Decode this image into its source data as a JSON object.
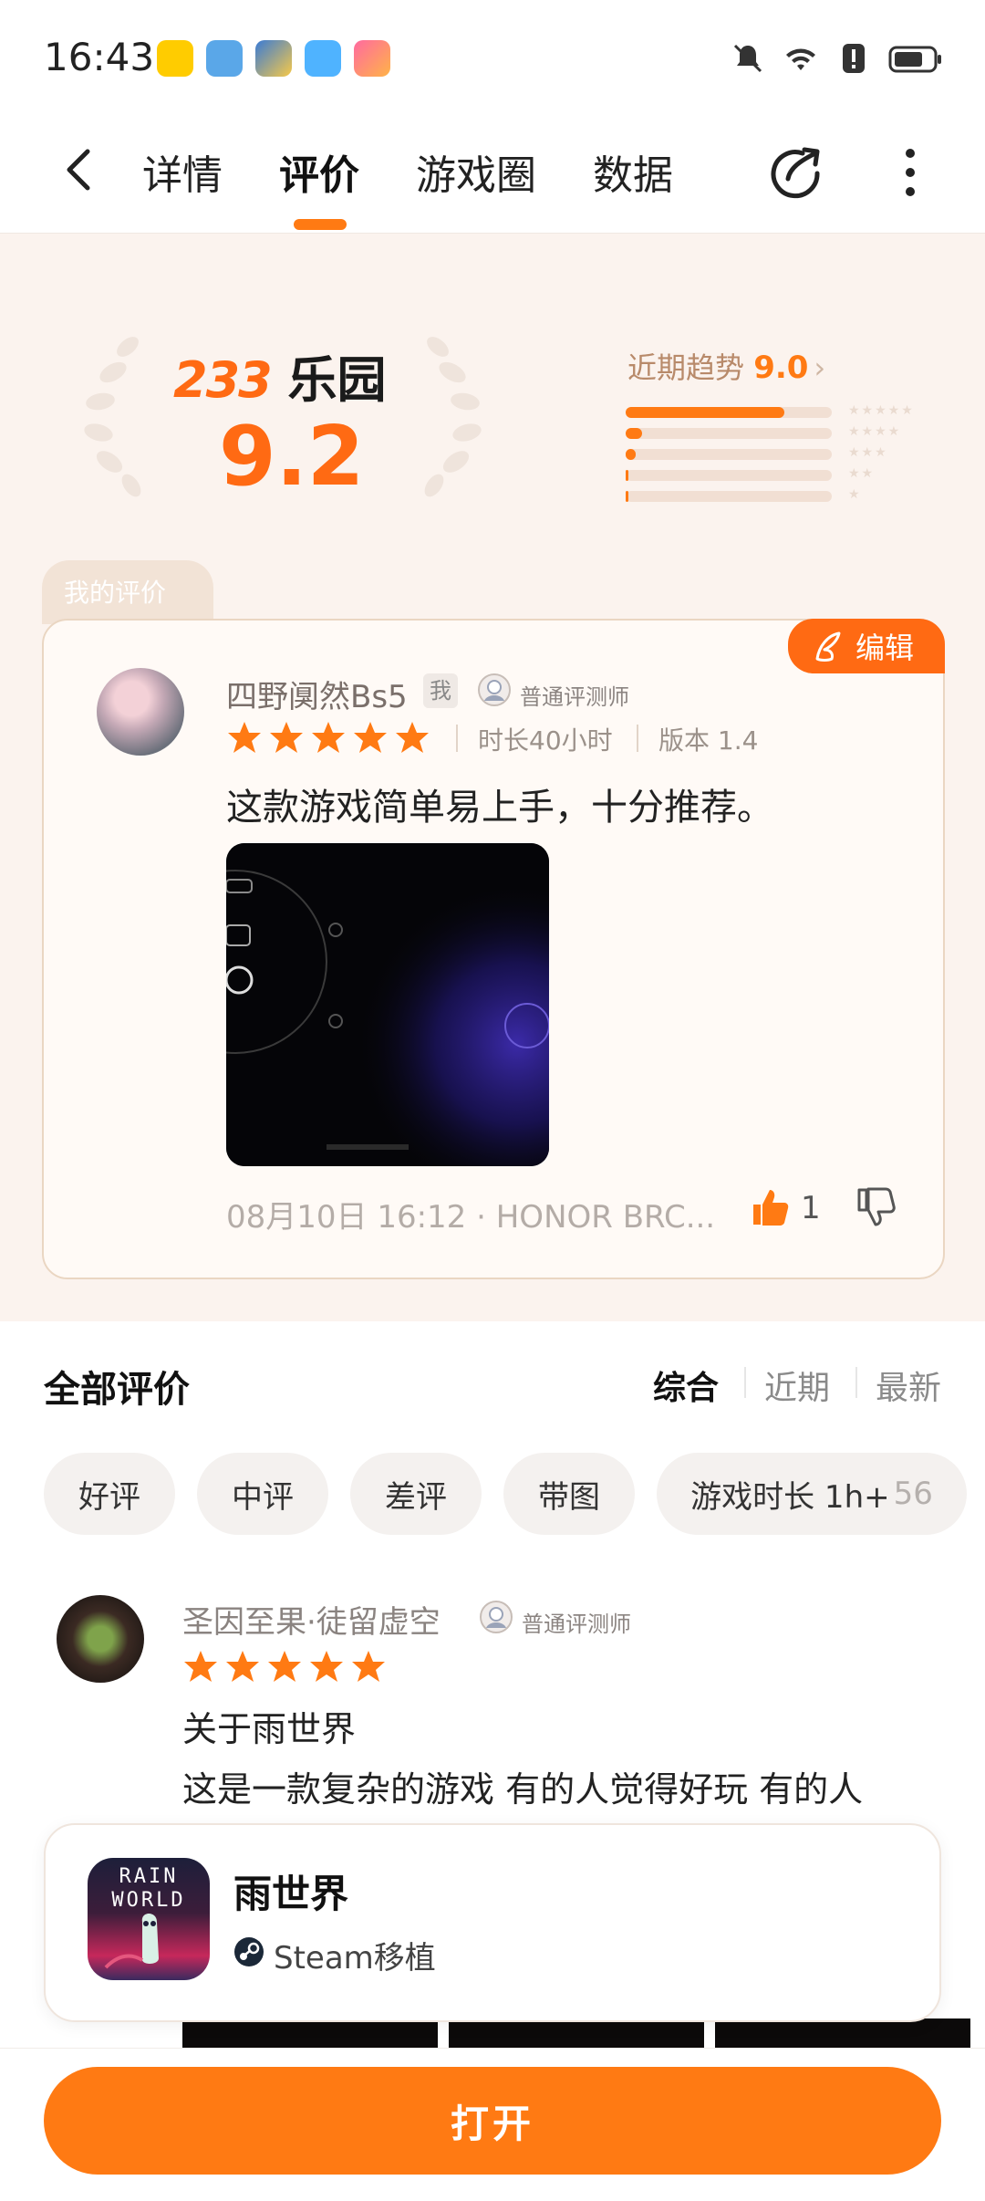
{
  "status_bar": {
    "time": "16:43"
  },
  "nav": {
    "tabs": [
      {
        "label": "详情"
      },
      {
        "label": "评价"
      },
      {
        "label": "游戏圈"
      },
      {
        "label": "数据"
      }
    ],
    "active_tab": "评价"
  },
  "score": {
    "brand_number": "233",
    "brand_text": "乐园",
    "value": "9.2",
    "trend_label": "近期趋势",
    "trend_value": "9.0",
    "distribution": [
      0.77,
      0.08,
      0.05,
      0.015,
      0.015
    ]
  },
  "my_review": {
    "tab_label": "我的评价",
    "edit_label": "编辑",
    "user_name": "四野阒然Bs5",
    "me_tag": "我",
    "rank": "普通评测师",
    "stars": 5,
    "playtime": "时长40小时",
    "version": "版本 1.4",
    "text": "这款游戏简单易上手，十分推荐。",
    "date_device": "08月10日 16:12 · HONOR BRC...",
    "likes": "1"
  },
  "all_reviews": {
    "title": "全部评价",
    "sort_options": [
      {
        "label": "综合"
      },
      {
        "label": "近期"
      },
      {
        "label": "最新"
      }
    ],
    "active_sort": "综合",
    "filters": [
      {
        "label": "好评"
      },
      {
        "label": "中评"
      },
      {
        "label": "差评"
      },
      {
        "label": "带图"
      },
      {
        "label": "游戏时长 1h+",
        "count": "56"
      }
    ],
    "review": {
      "user_name": "圣因至果·徒留虚空",
      "rank": "普通评测师",
      "stars": 5,
      "title": "关于雨世界",
      "body": "这是一款复杂的游戏 有的人觉得好玩 有的人"
    }
  },
  "game_card": {
    "icon_text": "RAIN WORLD",
    "title": "雨世界",
    "subtitle": "Steam移植"
  },
  "bottom": {
    "open_label": "打开"
  },
  "colors": {
    "accent": "#ff7a13",
    "background_warm": "#fbf3ee",
    "star": "#ff7a13"
  }
}
